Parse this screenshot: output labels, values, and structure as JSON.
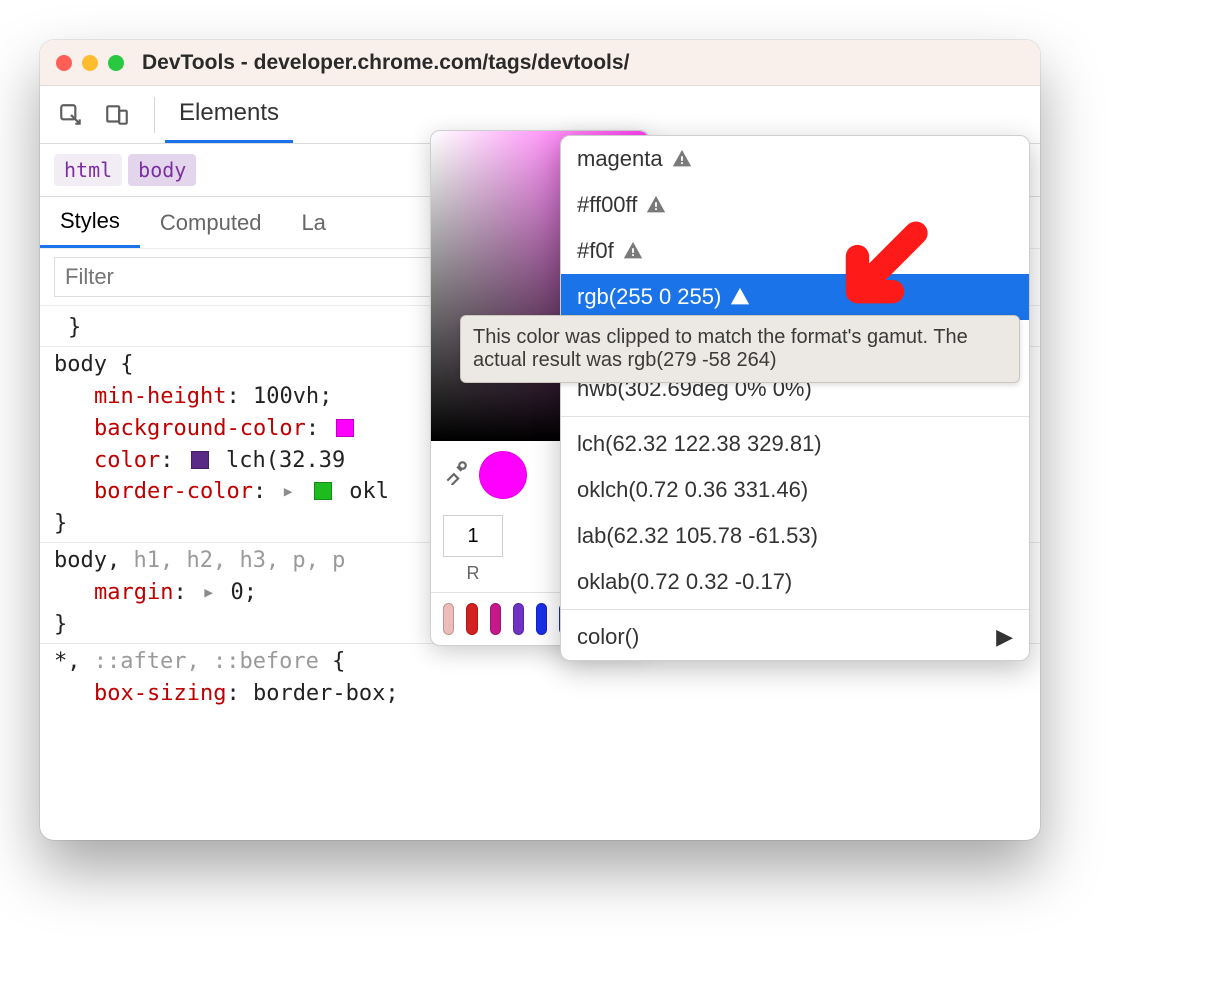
{
  "window": {
    "title": "DevTools - developer.chrome.com/tags/devtools/"
  },
  "tabs": {
    "main": "Elements"
  },
  "breadcrumbs": [
    "html",
    "body"
  ],
  "subtabs": [
    "Styles",
    "Computed",
    "La"
  ],
  "filter": {
    "placeholder": "Filter"
  },
  "rules": [
    {
      "selector": "body {",
      "declarations": [
        {
          "prop": "min-height",
          "value": "100vh;"
        },
        {
          "prop": "background-color",
          "value": "",
          "swatch": "magenta"
        },
        {
          "prop": "color",
          "swatch": "purple",
          "value": "lch(32.39 "
        },
        {
          "prop": "border-color",
          "expand": true,
          "swatch": "green",
          "value": "okl"
        }
      ],
      "close": "}"
    },
    {
      "selector": "body, ",
      "selector_muted": "h1, h2, h3, p, p",
      "declarations": [
        {
          "prop": "margin",
          "expand": true,
          "value": "0;"
        }
      ],
      "close": "}"
    },
    {
      "selector": "*, ",
      "selector_muted": "::after, ::before",
      "open": " {",
      "declarations": [
        {
          "prop": "box-sizing",
          "value": "border-box;"
        }
      ]
    }
  ],
  "picker": {
    "alpha": "1",
    "channel_label": "R",
    "swatches": [
      "#eebcb8",
      "#d32020",
      "#c5198a",
      "#6f33c4",
      "#1a2ee8",
      "#1744b3",
      "#1e6de3",
      "#2a88e8"
    ]
  },
  "menu": {
    "items_warn": [
      "magenta",
      "#ff00ff",
      "#f0f",
      "rgb(255 0 255)"
    ],
    "hsl_tail": "%)",
    "hwb": "hwb(302.69deg 0% 0%)",
    "wide": [
      "lch(62.32 122.38 329.81)",
      "oklch(0.72 0.36 331.46)",
      "lab(62.32 105.78 -61.53)",
      "oklab(0.72 0.32 -0.17)"
    ],
    "color_fn": "color()"
  },
  "tooltip": "This color was clipped to match the format's gamut. The actual result was rgb(279 -58 264)"
}
